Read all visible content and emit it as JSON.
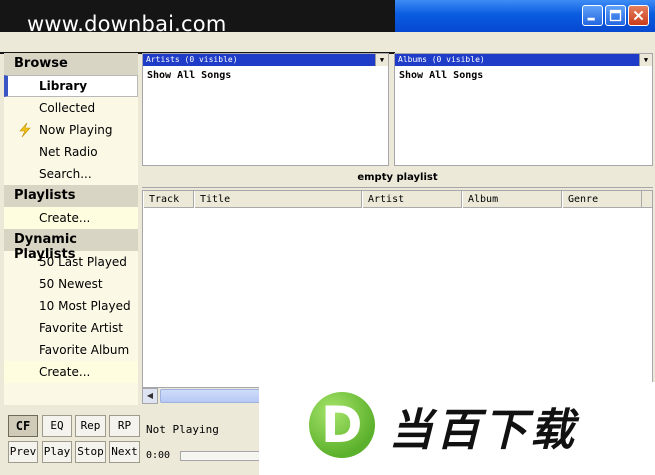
{
  "watermark": {
    "site": "www.downbai.com",
    "logo_letter": "D",
    "logo_text": "当百下载"
  },
  "colors": {
    "titlebar": "#0a5ce0",
    "selection_blue": "#1f3cc8",
    "logo_green": "#5cb12c",
    "sidebar_bg": "#fbf8e6"
  },
  "sidebar": {
    "browse": {
      "header": "Browse",
      "items": [
        {
          "label": "Library"
        },
        {
          "label": "Collected"
        },
        {
          "label": "Now Playing",
          "icon": "lightning-icon"
        },
        {
          "label": "Net Radio"
        },
        {
          "label": "Search..."
        }
      ]
    },
    "playlists": {
      "header": "Playlists",
      "items": [
        {
          "label": "Create..."
        }
      ]
    },
    "dynamic": {
      "header": "Dynamic Playlists",
      "items": [
        {
          "label": "50 Last Played"
        },
        {
          "label": "50 Newest"
        },
        {
          "label": "10 Most Played"
        },
        {
          "label": "Favorite Artist"
        },
        {
          "label": "Favorite Album"
        },
        {
          "label": "Create..."
        }
      ]
    }
  },
  "panes": {
    "artists": {
      "header": "Artists (0 visible)",
      "row": "Show All Songs"
    },
    "albums": {
      "header": "Albums (0 visible)",
      "row": "Show All Songs"
    }
  },
  "playlist": {
    "title": "empty playlist",
    "columns": [
      "Track",
      "Title",
      "Artist",
      "Album",
      "Genre"
    ]
  },
  "controls": {
    "row1": [
      "CF",
      "EQ",
      "Rep",
      "RP"
    ],
    "row2": [
      "Prev",
      "Play",
      "Stop",
      "Next"
    ],
    "status": "Not Playing",
    "time": "0:00"
  }
}
